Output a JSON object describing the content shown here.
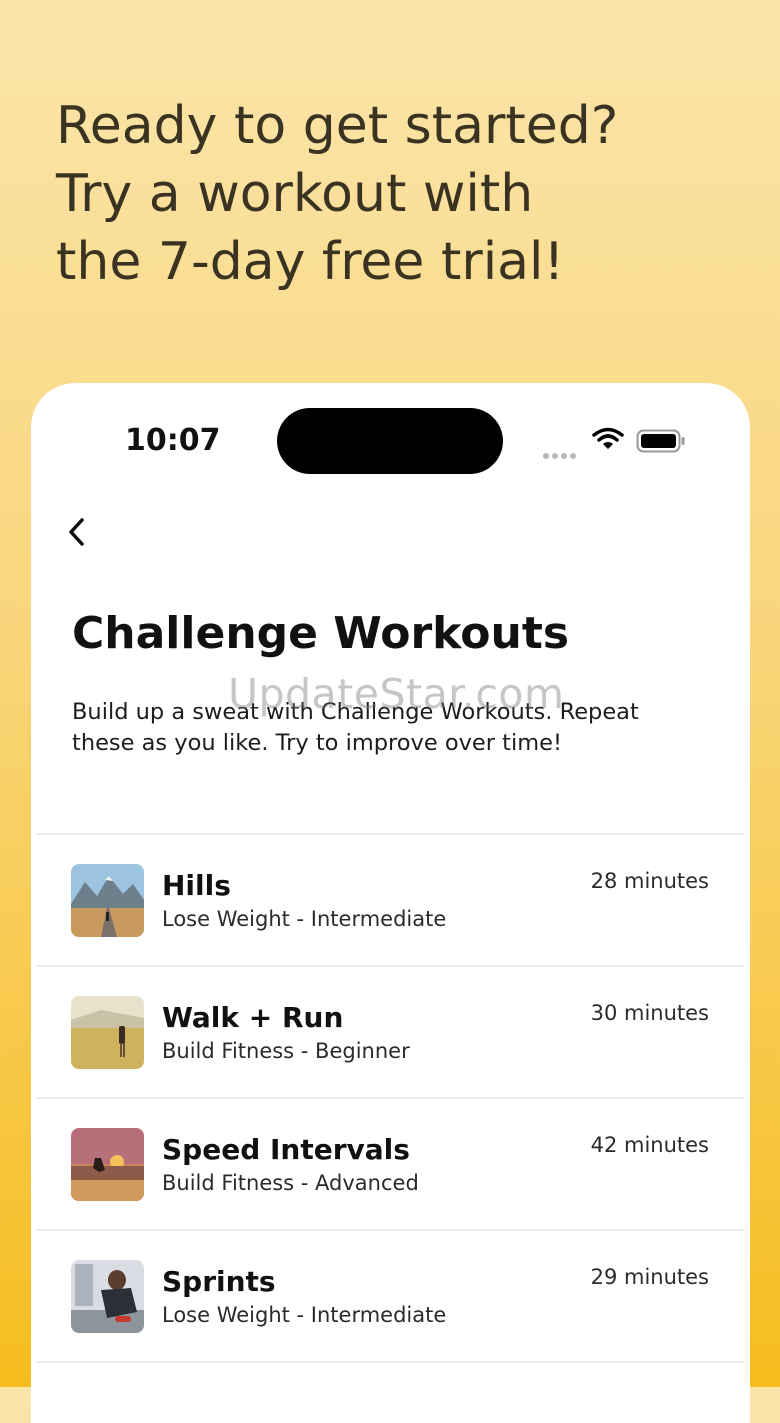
{
  "promo": {
    "line1": "Ready to get started?",
    "line2": "Try a workout with",
    "line3": "the 7-day free trial!"
  },
  "status_bar": {
    "time": "10:07",
    "icons": [
      "signal-dots-icon",
      "wifi-icon",
      "battery-icon"
    ]
  },
  "nav": {
    "back_icon": "chevron-left-icon"
  },
  "page": {
    "title": "Challenge Workouts",
    "description": "Build up a sweat with Challenge Workouts. Repeat these as you like. Try to improve over time!"
  },
  "watermark": "UpdateStar.com",
  "workouts": [
    {
      "name": "Hills",
      "subtitle": "Lose Weight - Intermediate",
      "duration": "28 minutes",
      "thumb": "mountain-road-runner"
    },
    {
      "name": "Walk + Run",
      "subtitle": "Build Fitness - Beginner",
      "duration": "30 minutes",
      "thumb": "field-runner"
    },
    {
      "name": "Speed Intervals",
      "subtitle": "Build Fitness - Advanced",
      "duration": "42 minutes",
      "thumb": "sunset-beach-runner"
    },
    {
      "name": "Sprints",
      "subtitle": "Lose Weight - Intermediate",
      "duration": "29 minutes",
      "thumb": "runner-tying-shoe"
    }
  ],
  "colors": {
    "background_top": "#fbe5ab",
    "background_bottom": "#f6bd1f",
    "headline_text": "#3b3322",
    "card": "#ffffff"
  }
}
